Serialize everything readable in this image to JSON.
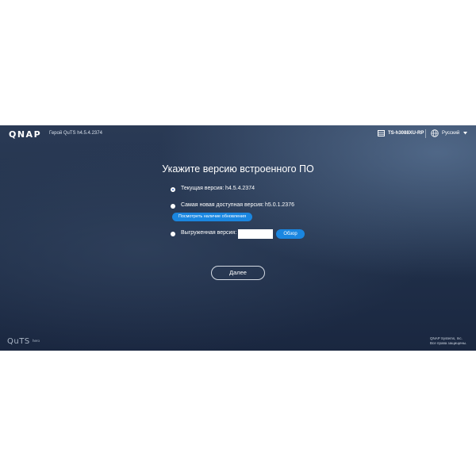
{
  "header": {
    "logo": "QNAP",
    "title": "Герой QuTS h4.5.4.2374",
    "model": "TS-h3088XU-RP",
    "language": "Русский",
    "icons": {
      "model": "device-icon",
      "language": "globe-icon",
      "dropdown": "caret-down-icon"
    }
  },
  "main": {
    "title": "Укажите версию встроенного ПО",
    "options": [
      {
        "label": "Текущая версия:",
        "value": "h4.5.4.2374",
        "selected": true
      },
      {
        "label": "Самая новая доступная версия:",
        "value": "h5.0.1.2376",
        "selected": false
      },
      {
        "label": "Выгруженная версия:",
        "value": "",
        "selected": false
      }
    ],
    "check_updates_label": "Посмотреть наличие обновления",
    "browse_label": "Обзор",
    "next_label": "Далее"
  },
  "footer": {
    "logo": "QuTS",
    "logo_suffix": "hero",
    "company": "QNAP Systems, Inc.",
    "rights": "Все права защищены."
  },
  "colors": {
    "accent": "#1a86e0",
    "background": "#22324c"
  }
}
